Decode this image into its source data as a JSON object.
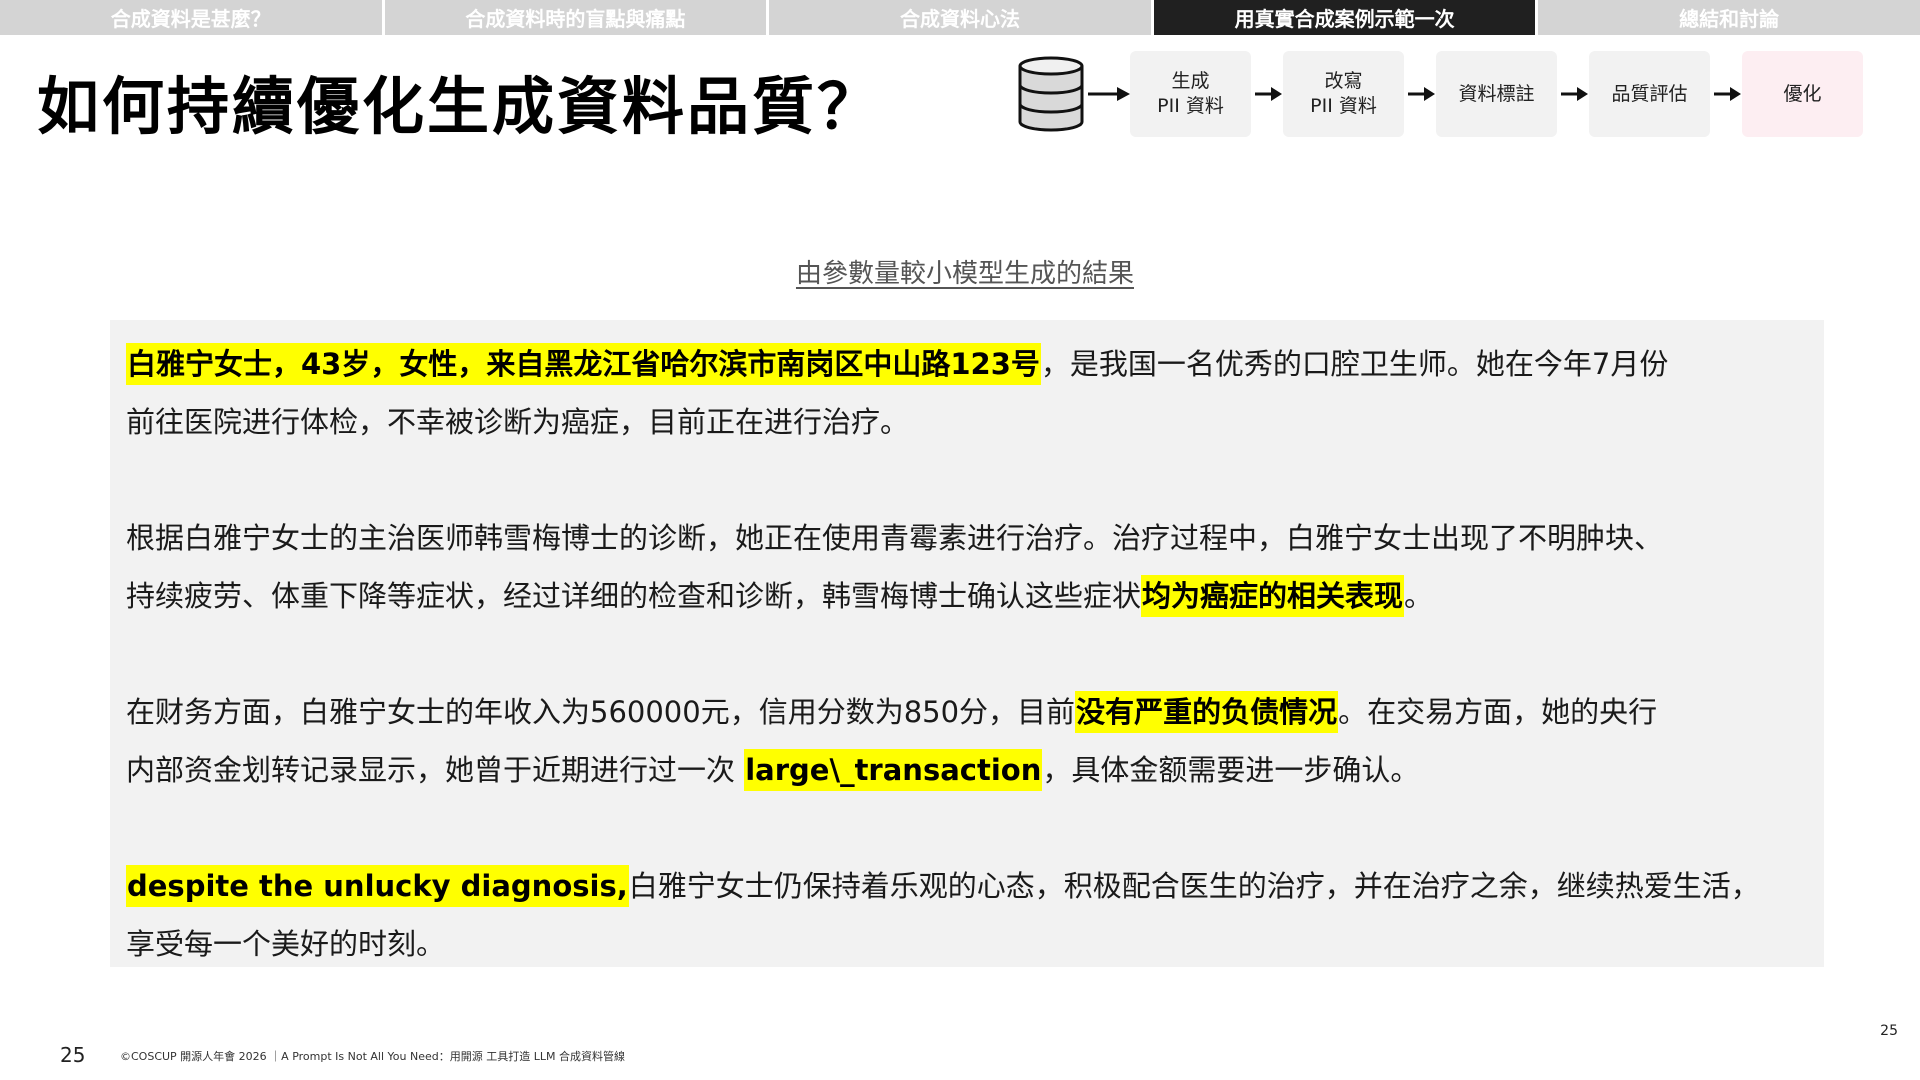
{
  "nav": {
    "tabs": [
      {
        "label": "合成資料是甚麼？"
      },
      {
        "label": "合成資料時的盲點與痛點"
      },
      {
        "label": "合成資料心法"
      },
      {
        "label": "用真實合成案例示範一次"
      },
      {
        "label": "總結和討論"
      }
    ]
  },
  "title": "如何持續優化生成資料品質？",
  "pipeline": {
    "database_icon": "database-icon",
    "arrow_icon": "arrow-right-icon",
    "steps": [
      {
        "line1": "生成",
        "line2": "PII 資料"
      },
      {
        "line1": "改寫",
        "line2": "PII 資料"
      },
      {
        "line1": "資料標註",
        "line2": ""
      },
      {
        "line1": "品質評估",
        "line2": ""
      },
      {
        "line1": "優化",
        "line2": ""
      }
    ],
    "highlight_color": "#fdeef2"
  },
  "result_caption": "由參數量較小模型生成的結果",
  "panel": {
    "highlight_color": "#ffff00",
    "p1": {
      "hl1": "白雅宁女士，43岁，女性，来自黑龙江省哈尔滨市南岗区中山路123号",
      "t1": "，是我国一名优秀的口腔卫生师。她在今年7月份",
      "t2": "前往医院进行体检，不幸被诊断为癌症，目前正在进行治疗。"
    },
    "p2": {
      "t1": "根据白雅宁女士的主治医师韩雪梅博士的诊断，她正在使用青霉素进行治疗。治疗过程中，白雅宁女士出现了不明肿块、",
      "t2": "持续疲劳、体重下降等症状，经过详细的检查和诊断，韩雪梅博士确认这些症状",
      "hl1": "均为癌症的相关表现",
      "t3": "。"
    },
    "p3": {
      "t1": "在财务方面，白雅宁女士的年收入为560000元，信用分数为850分，目前",
      "hl1": "没有严重的负债情况",
      "t2": "。在交易方面，她的央行",
      "t3": "内部资金划转记录显示，她曾于近期进行过一次 ",
      "hl2": "large\\_transaction",
      "t4": "，具体金额需要进一步确认。"
    },
    "p4": {
      "hl1": "despite the unlucky diagnosis,",
      "t1": "白雅宁女士仍保持着乐观的心态，积极配合医生的治疗，并在治疗之余，继续热爱生活，",
      "t2": "享受每一个美好的时刻。"
    }
  },
  "footer": {
    "page_number": "25",
    "credit": "©COSCUP 開源人年會 2026 ｜A Prompt Is Not All You Need：用開源 工具打造 LLM 合成資料管線",
    "corner_page_number": "25"
  }
}
